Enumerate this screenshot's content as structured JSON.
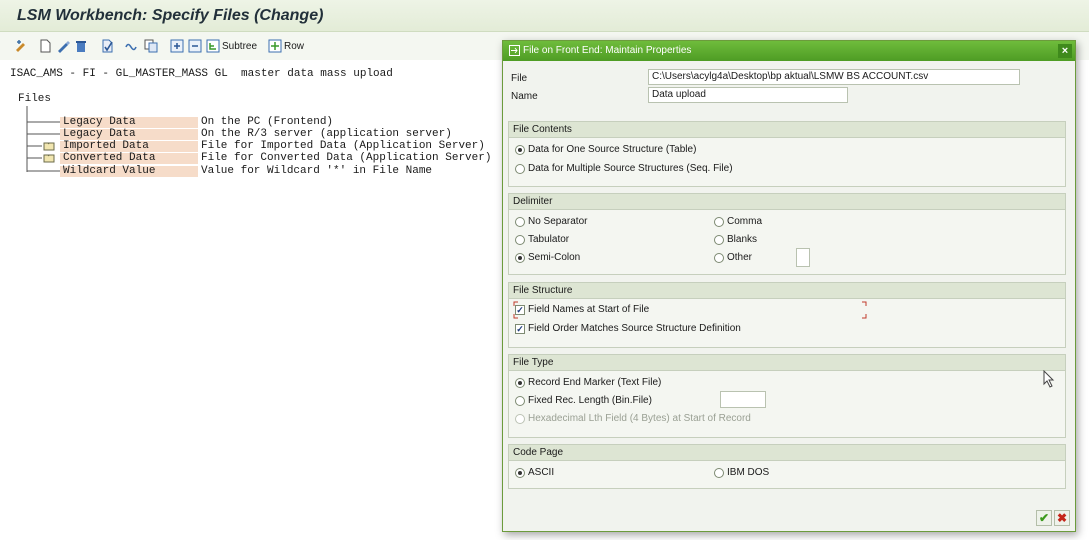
{
  "window": {
    "title": "LSM Workbench: Specify Files (Change)"
  },
  "toolbar": {
    "icons": [
      "display-change-icon",
      "new-icon",
      "edit-icon",
      "delete-icon",
      "check-icon",
      "link-icon",
      "copy-icon",
      "expand-icon",
      "collapse-icon"
    ],
    "subtree_label": "Subtree",
    "row_label": "Row"
  },
  "project": {
    "line": "ISAC_AMS - FI - GL_MASTER_MASS GL  master data mass upload",
    "files_label": "Files"
  },
  "tree": [
    {
      "node": "Legacy Data",
      "desc": "On the PC (Frontend)",
      "icon": ""
    },
    {
      "node": "Legacy Data",
      "desc": "On the R/3 server (application server)",
      "icon": ""
    },
    {
      "node": "Imported Data",
      "desc": "File for Imported Data (Application Server)",
      "icon": "folder-icon"
    },
    {
      "node": "Converted Data",
      "desc": "File for Converted Data (Application Server)",
      "icon": "folder-icon"
    },
    {
      "node": "Wildcard Value",
      "desc": "Value for Wildcard '*' in File Name",
      "icon": ""
    }
  ],
  "dialog": {
    "title": "File on Front End: Maintain Properties",
    "close_label": "×",
    "file_label": "File",
    "file_value": "C:\\Users\\acylg4a\\Desktop\\bp aktual\\LSMW BS ACCOUNT.csv",
    "name_label": "Name",
    "name_value": "Data upload",
    "file_contents": {
      "header": "File Contents",
      "option1": "Data for One Source Structure (Table)",
      "option2": "Data for Multiple Source Structures (Seq. File)"
    },
    "delimiter": {
      "header": "Delimiter",
      "no_separator": "No Separator",
      "tabulator": "Tabulator",
      "semi_colon": "Semi-Colon",
      "comma": "Comma",
      "blanks": "Blanks",
      "other": "Other"
    },
    "file_structure": {
      "header": "File Structure",
      "field_names": "Field Names at Start of File",
      "field_order": "Field Order Matches Source Structure Definition"
    },
    "file_type": {
      "header": "File Type",
      "record_end": "Record End Marker (Text File)",
      "fixed_len": "Fixed Rec. Length (Bin.File)",
      "hex_len": "Hexadecimal Lth Field (4 Bytes) at Start of Record"
    },
    "code_page": {
      "header": "Code Page",
      "ascii": "ASCII",
      "ibm_dos": "IBM DOS"
    },
    "ok_label": "✔",
    "cancel_label": "✖"
  },
  "colors": {
    "dialog_header": "#5aa82e",
    "tree_node_bg": "#f6dcc9",
    "title_bg": "#e8f0dd"
  }
}
